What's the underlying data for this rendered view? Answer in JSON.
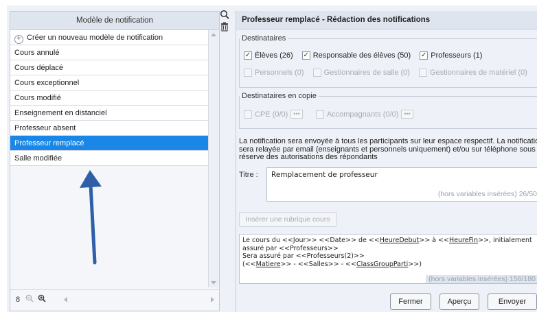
{
  "left_panel": {
    "header": "Modèle de notification",
    "create_label": "Créer un nouveau modèle de notification",
    "items": [
      "Cours annulé",
      "Cours déplacé",
      "Cours exceptionnel",
      "Cours modifié",
      "Enseignement en distanciel",
      "Professeur absent",
      "Professeur remplacé",
      "Salle modifiée"
    ],
    "selected_item": "Professeur remplacé",
    "zoom_level": "8"
  },
  "right_panel": {
    "title": "Professeur remplacé - Rédaction des notifications",
    "destinataires": {
      "legend": "Destinataires",
      "row1": [
        {
          "label": "Élèves (26)",
          "checked": true
        },
        {
          "label": "Responsable des élèves (50)",
          "checked": true
        },
        {
          "label": "Professeurs (1)",
          "checked": true
        }
      ],
      "row2": [
        {
          "label": "Personnels (0)",
          "checked": false
        },
        {
          "label": "Gestionnaires de salle (0)",
          "checked": false
        },
        {
          "label": "Gestionnaires de matériel (0)",
          "checked": false
        }
      ]
    },
    "copie": {
      "legend": "Destinataires en copie",
      "items": [
        {
          "label": "CPE (0/0)",
          "dots": "•••"
        },
        {
          "label": "Accompagnants (0/0)",
          "dots": "•••"
        }
      ]
    },
    "notice_line1": "La notification sera envoyée à tous les participants sur leur espace respectif. La notification",
    "notice_line2": "sera relayée par email (enseignants et personnels uniquement) et/ou sur téléphone sous",
    "notice_line3": "réserve des autorisations des répondants",
    "titre_label": "Titre :",
    "titre_value": "Remplacement de professeur",
    "titre_count": "(hors variables insérées) 26/50",
    "insert_button": "Insérer une rubrique cours",
    "body_line1_a": "Le cours du <<Jour>> <<Date>> de <<",
    "body_line1_u1": "HeureDebut",
    "body_line1_b": ">> à <<",
    "body_line1_u2": "HeureFin",
    "body_line1_c": ">>, initialement",
    "body_line2": "assuré par <<Professeurs>>",
    "body_line3": "Sera assuré par <<Professeurs(2)>>",
    "body_line4_a": "(<<",
    "body_line4_u1": "Matiere",
    "body_line4_b": ">> - <<Salles>> - <<",
    "body_line4_u2": "ClassGroupParti",
    "body_line4_c": ">>)",
    "body_count": "(hors variables insérées) 156/180",
    "buttons": {
      "close": "Fermer",
      "preview": "Aperçu",
      "send": "Envoyer"
    }
  },
  "colors": {
    "selection": "#1a86e6",
    "arrow": "#2f5fa8",
    "header_bg": "#dfe5ee"
  }
}
